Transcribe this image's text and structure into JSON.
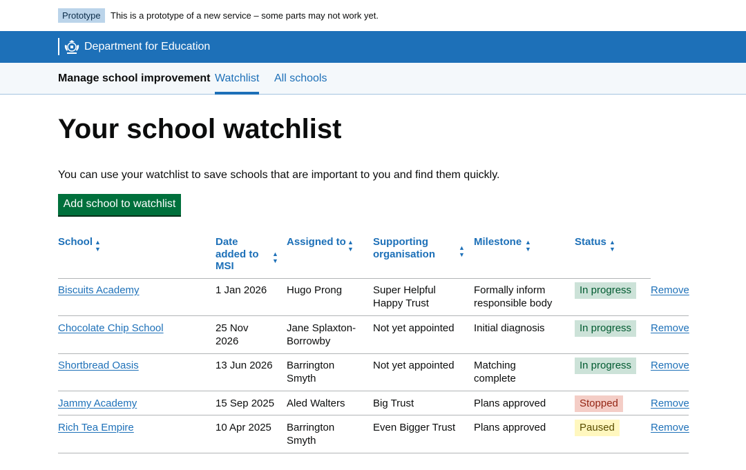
{
  "phase_banner": {
    "tag": "Prototype",
    "message": "This is a prototype of a new service – some parts may not work yet."
  },
  "header": {
    "department": "Department for Education",
    "logo_icon": "royal-crest-icon"
  },
  "service_nav": {
    "service_name": "Manage school improvement",
    "items": [
      {
        "label": "Watchlist",
        "active": true
      },
      {
        "label": "All schools",
        "active": false
      }
    ]
  },
  "page": {
    "title": "Your school watchlist",
    "intro": "You can use your watchlist to save schools that are important to you and find them quickly.",
    "add_button": "Add school to watchlist"
  },
  "table": {
    "headers": {
      "school": "School",
      "date_line1": "Date",
      "date_line2": "added to",
      "date_line3": "MSI",
      "assigned": "Assigned to",
      "supporting_line1": "Supporting",
      "supporting_line2": "organisation",
      "milestone": "Milestone",
      "status": "Status"
    },
    "sort_icon": "sort-arrows-icon",
    "remove_label": "Remove",
    "rows": [
      {
        "school": "Biscuits Academy",
        "date": "1 Jan 2026",
        "assigned_l1": "Hugo Prong",
        "assigned_l2": "",
        "supporting_l1": "Super Helpful",
        "supporting_l2": "Happy Trust",
        "milestone_l1": "Formally inform",
        "milestone_l2": "responsible body",
        "status": "In progress",
        "status_color": "#cce2d8"
      },
      {
        "school": "Chocolate Chip School",
        "date_l1": "25 Nov",
        "date_l2": "2026",
        "assigned_l1": "Jane Splaxton-",
        "assigned_l2": "Borrowby",
        "supporting_l1": "Not yet appointed",
        "milestone_l1": "Initial diagnosis",
        "status": "In progress",
        "status_color": "#cce2d8"
      },
      {
        "school": "Shortbread Oasis",
        "date": "13 Jun 2026",
        "assigned_l1": "Barrington",
        "assigned_l2": "Smyth",
        "supporting_l1": "Not yet appointed",
        "milestone_l1": "Matching",
        "milestone_l2": "complete",
        "status": "In progress",
        "status_color": "#cce2d8"
      },
      {
        "school": "Jammy Academy",
        "date": "15 Sep 2025",
        "assigned_l1": "Aled Walters",
        "supporting_l1": "Big Trust",
        "milestone_l1": "Plans approved",
        "status": "Stopped",
        "status_color": "#f4cdc6"
      },
      {
        "school": "Rich Tea Empire",
        "date": "10 Apr 2025",
        "assigned_l1": "Barrington",
        "assigned_l2": "Smyth",
        "supporting_l1": "Even Bigger Trust",
        "milestone_l1": "Plans approved",
        "status": "Paused",
        "status_color": "#fff7bf"
      }
    ]
  },
  "colors": {
    "header_blue": "#1d70b8",
    "button_green": "#00703c",
    "tag_blue": "#bbd4ea"
  }
}
